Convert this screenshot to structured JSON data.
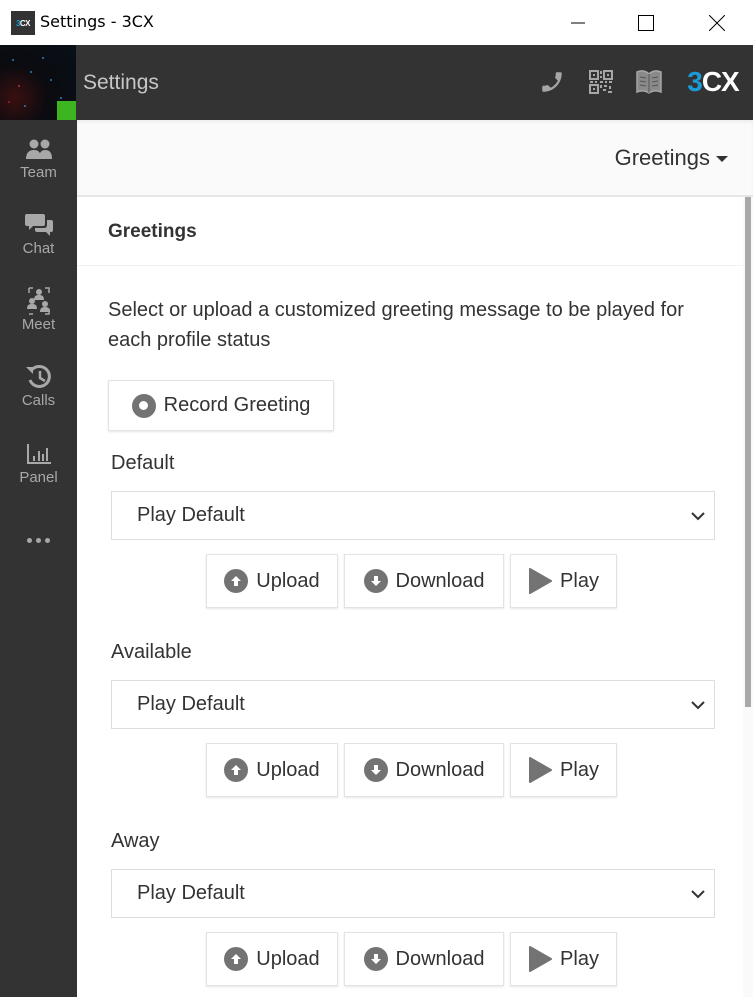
{
  "window": {
    "title": "Settings - 3CX",
    "app_icon_text_prefix": "3",
    "app_icon_text_suffix": "CX",
    "controls": [
      "minimize",
      "maximize",
      "close"
    ]
  },
  "header": {
    "title": "Settings",
    "icons": [
      "phone-icon",
      "qr-code-icon",
      "book-icon"
    ],
    "logo_prefix": "3",
    "logo_suffix": "CX",
    "status_color": "#3cb521",
    "brand_color": "#1a9ad6"
  },
  "sidebar": {
    "items": [
      {
        "label": "Team",
        "icon": "team-icon"
      },
      {
        "label": "Chat",
        "icon": "chat-icon"
      },
      {
        "label": "Meet",
        "icon": "meet-icon"
      },
      {
        "label": "Calls",
        "icon": "history-icon"
      },
      {
        "label": "Panel",
        "icon": "panel-icon"
      }
    ],
    "more_icon": "more-icon"
  },
  "subheader": {
    "dropdown_label": "Greetings"
  },
  "main": {
    "section_title": "Greetings",
    "description": "Select or upload a customized greeting message to be played for each profile status",
    "record_button": "Record Greeting",
    "groups": [
      {
        "label": "Default",
        "selected": "Play Default",
        "upload": "Upload",
        "download": "Download",
        "play": "Play"
      },
      {
        "label": "Available",
        "selected": "Play Default",
        "upload": "Upload",
        "download": "Download",
        "play": "Play"
      },
      {
        "label": "Away",
        "selected": "Play Default",
        "upload": "Upload",
        "download": "Download",
        "play": "Play"
      }
    ]
  }
}
